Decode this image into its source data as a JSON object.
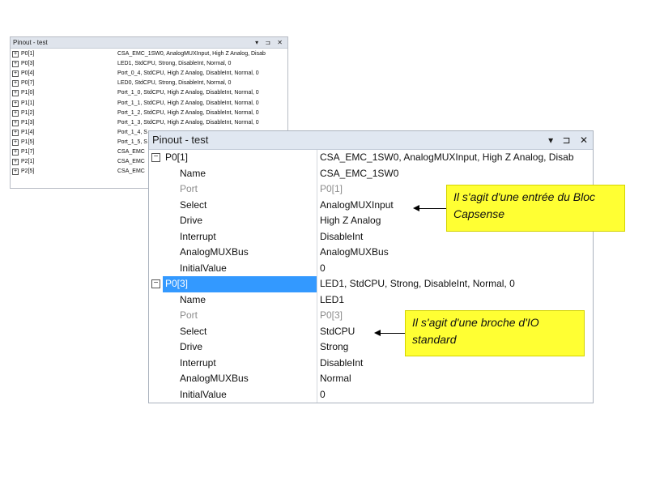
{
  "small_panel": {
    "title": "Pinout - test",
    "controls": "▾ ⊐ ✕",
    "rows": [
      {
        "name": "P0[1]",
        "value": "CSA_EMC_1SW0, AnalogMUXInput, High Z Analog, Disab"
      },
      {
        "name": "P0[3]",
        "value": "LED1, StdCPU, Strong, DisableInt, Normal, 0"
      },
      {
        "name": "P0[4]",
        "value": "Port_0_4, StdCPU, High Z Analog, DisableInt, Normal, 0"
      },
      {
        "name": "P0[7]",
        "value": "LED0, StdCPU, Strong, DisableInt, Normal, 0"
      },
      {
        "name": "P1[0]",
        "value": "Port_1_0, StdCPU, High Z Analog, DisableInt, Normal, 0"
      },
      {
        "name": "P1[1]",
        "value": "Port_1_1, StdCPU, High Z Analog, DisableInt, Normal, 0"
      },
      {
        "name": "P1[2]",
        "value": "Port_1_2, StdCPU, High Z Analog, DisableInt, Normal, 0"
      },
      {
        "name": "P1[3]",
        "value": "Port_1_3, StdCPU, High Z Analog, DisableInt, Normal, 0"
      },
      {
        "name": "P1[4]",
        "value": "Port_1_4, S"
      },
      {
        "name": "P1[5]",
        "value": "Port_1_5, S"
      },
      {
        "name": "P1[7]",
        "value": "CSA_EMC"
      },
      {
        "name": "P2[1]",
        "value": "CSA_EMC"
      },
      {
        "name": "P2[5]",
        "value": "CSA_EMC"
      }
    ]
  },
  "big_panel": {
    "title": "Pinout - test",
    "ctrl_dropdown": "▾",
    "ctrl_pin": "⊐",
    "ctrl_close": "✕",
    "group1": {
      "name": "P0[1]",
      "value": "CSA_EMC_1SW0, AnalogMUXInput, High Z Analog, Disab",
      "props": [
        {
          "name": "Name",
          "value": "CSA_EMC_1SW0"
        },
        {
          "name": "Port",
          "value": "P0[1]"
        },
        {
          "name": "Select",
          "value": "AnalogMUXInput"
        },
        {
          "name": "Drive",
          "value": "High Z Analog"
        },
        {
          "name": "Interrupt",
          "value": "DisableInt"
        },
        {
          "name": "AnalogMUXBus",
          "value": "AnalogMUXBus"
        },
        {
          "name": "InitialValue",
          "value": "0"
        }
      ]
    },
    "group2": {
      "name": "P0[3]",
      "value": "LED1, StdCPU, Strong, DisableInt, Normal, 0",
      "props": [
        {
          "name": "Name",
          "value": "LED1"
        },
        {
          "name": "Port",
          "value": "P0[3]"
        },
        {
          "name": "Select",
          "value": "StdCPU"
        },
        {
          "name": "Drive",
          "value": "Strong"
        },
        {
          "name": "Interrupt",
          "value": "DisableInt"
        },
        {
          "name": "AnalogMUXBus",
          "value": "Normal"
        },
        {
          "name": "InitialValue",
          "value": "0"
        }
      ]
    }
  },
  "callouts": {
    "capsense": "Il s'agit d'une entrée du Bloc Capsense",
    "io": "Il s'agit d'une broche d'IO standard"
  }
}
